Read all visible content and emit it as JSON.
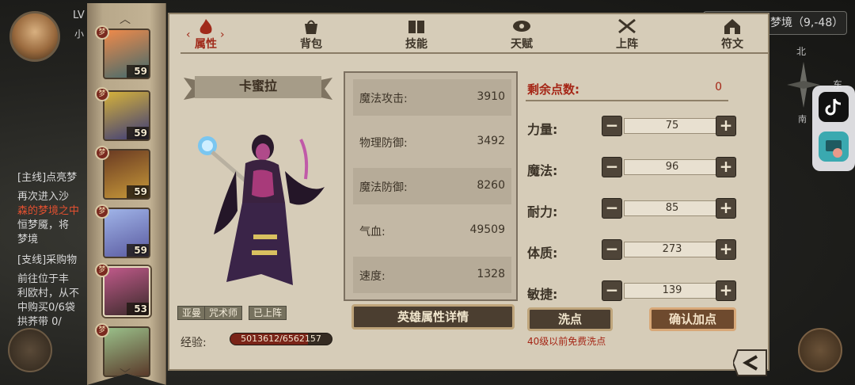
{
  "background": {
    "player_level": "LV",
    "player_sub": "小",
    "coord_text": "梦境（9,-48）",
    "compass": {
      "north": "北",
      "south": "南",
      "east": "东"
    },
    "quests": [
      {
        "text": "[主线]点亮梦",
        "color": "#d8d8d8"
      },
      {
        "text": "再次进入沙",
        "color": "#d8d8d8"
      },
      {
        "text": "森的梦境之中",
        "color": "#e35030"
      },
      {
        "text": "恒梦魇，将",
        "color": "#d8d8d8"
      },
      {
        "text": "梦境",
        "color": "#d8d8d8"
      },
      {
        "text": "[支线]采购物",
        "color": "#d8d8d8"
      },
      {
        "text": "前往位于丰",
        "color": "#d8d8d8"
      },
      {
        "text": "利欧村，从不",
        "color": "#d8d8d8"
      },
      {
        "text": "中购买0/6袋",
        "color": "#d8d8d8"
      },
      {
        "text": "拱荞带  0/",
        "color": "#d8d8d8"
      }
    ]
  },
  "tabs": [
    {
      "label": "属性",
      "icon": "flame-icon",
      "active": true
    },
    {
      "label": "背包",
      "icon": "bag-icon",
      "active": false
    },
    {
      "label": "技能",
      "icon": "book-icon",
      "active": false
    },
    {
      "label": "天赋",
      "icon": "eye-icon",
      "active": false
    },
    {
      "label": "上阵",
      "icon": "crossed-swords-icon",
      "active": false
    },
    {
      "label": "符文",
      "icon": "rune-house-icon",
      "active": false
    }
  ],
  "heroes": [
    {
      "level": "59",
      "colors": [
        "#f08a4a",
        "#3f6a6e"
      ],
      "badge": "梦"
    },
    {
      "level": "59",
      "colors": [
        "#d6b23a",
        "#3a3a7a"
      ],
      "badge": "梦"
    },
    {
      "level": "59",
      "colors": [
        "#6a3a22",
        "#c89a3a"
      ],
      "badge": "梦"
    },
    {
      "level": "59",
      "colors": [
        "#a0b4e8",
        "#5a5aa0"
      ],
      "badge": "梦"
    },
    {
      "level": "53",
      "colors": [
        "#c05a8a",
        "#3a2a2a"
      ],
      "badge": "梦",
      "selected": true
    },
    {
      "level": "",
      "colors": [
        "#9ac08a",
        "#5a3a2a"
      ],
      "badge": "梦"
    }
  ],
  "hero": {
    "name": "卡蜜拉",
    "tags": [
      "亚曼",
      "咒术师",
      "已上阵"
    ],
    "exp_label": "经验:",
    "exp_text": "5013612/6562157",
    "exp_current": 5013612,
    "exp_max": 6562157
  },
  "stats": [
    {
      "label": "魔法攻击:",
      "value": "3910"
    },
    {
      "label": "物理防御:",
      "value": "3492"
    },
    {
      "label": "魔法防御:",
      "value": "8260"
    },
    {
      "label": "气血:",
      "value": "49509"
    },
    {
      "label": "速度:",
      "value": "1328"
    }
  ],
  "details_button": "英雄属性详情",
  "allocation": {
    "remaining_label": "剩余点数:",
    "remaining_value": "0",
    "attributes": [
      {
        "name": "力量:",
        "value": "75"
      },
      {
        "name": "魔法:",
        "value": "96"
      },
      {
        "name": "耐力:",
        "value": "85"
      },
      {
        "name": "体质:",
        "value": "273"
      },
      {
        "name": "敏捷:",
        "value": "139"
      }
    ],
    "minus_label": "−",
    "plus_label": "+"
  },
  "buttons": {
    "wash": "洗点",
    "confirm": "确认加点",
    "wash_note": "40级以前免费洗点"
  },
  "colors": {
    "accent_red": "#a52616",
    "panel_bg": "#d6ccb8"
  }
}
